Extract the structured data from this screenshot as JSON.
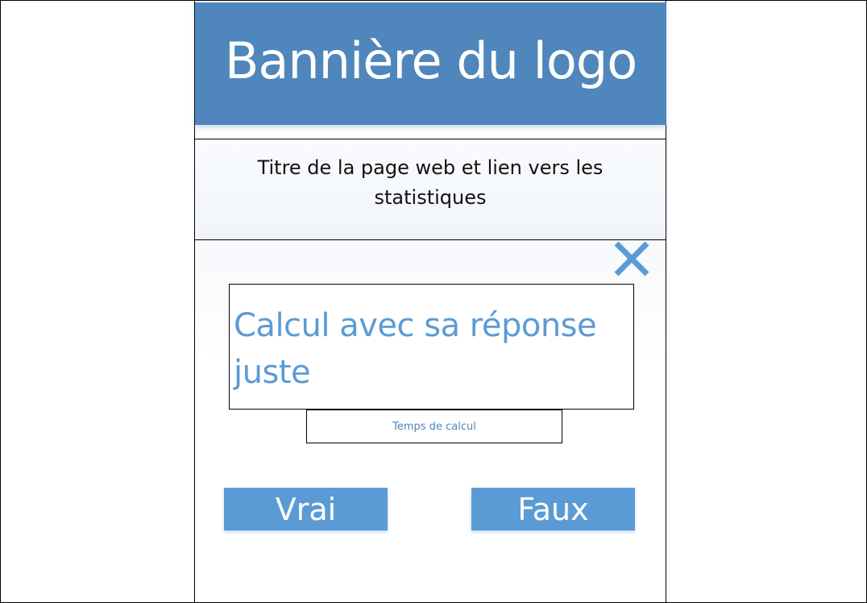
{
  "banner": {
    "logo_text": "Bannière du logo"
  },
  "title_section": {
    "text": "Titre de la page web et lien vers les statistiques"
  },
  "close_button": {
    "icon": "close-icon",
    "color": "#5b9bd5"
  },
  "calculation": {
    "text": "Calcul avec sa réponse juste"
  },
  "timer": {
    "label": "Temps de calcul"
  },
  "answers": {
    "true_label": "Vrai",
    "false_label": "Faux"
  },
  "colors": {
    "banner": "#4f87bc",
    "accent": "#5b9bd5",
    "button_text": "#ffffff"
  }
}
